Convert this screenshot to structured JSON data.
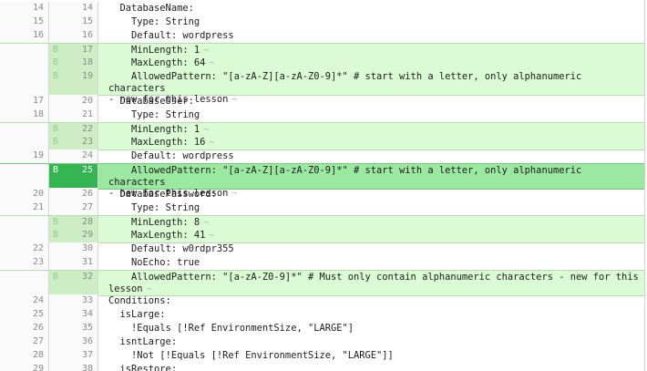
{
  "diff": {
    "added_marker": "B",
    "newline_glyph": "¬",
    "lines": [
      {
        "old": "14",
        "new": "14",
        "type": "context",
        "text": "  DatabaseName:",
        "nl": false
      },
      {
        "old": "15",
        "new": "15",
        "type": "context",
        "text": "    Type: String",
        "nl": false
      },
      {
        "old": "16",
        "new": "16",
        "type": "context",
        "text": "    Default: wordpress",
        "nl": false
      },
      {
        "old": "",
        "new": "17",
        "type": "added",
        "text": "    MinLength: 1",
        "nl": true
      },
      {
        "old": "",
        "new": "18",
        "type": "added",
        "text": "    MaxLength: 64",
        "nl": true
      },
      {
        "old": "",
        "new": "19",
        "type": "added",
        "text": "    AllowedPattern: \"[a-zA-Z][a-zA-Z0-9]*\" # start with a letter, only alphanumeric characters\n- new for this lesson",
        "nl": true
      },
      {
        "old": "17",
        "new": "20",
        "type": "context",
        "text": "  DatabaseUser:",
        "nl": false
      },
      {
        "old": "18",
        "new": "21",
        "type": "context",
        "text": "    Type: String",
        "nl": false
      },
      {
        "old": "",
        "new": "22",
        "type": "added",
        "text": "    MinLength: 1",
        "nl": true
      },
      {
        "old": "",
        "new": "23",
        "type": "added",
        "text": "    MaxLength: 16",
        "nl": true
      },
      {
        "old": "19",
        "new": "24",
        "type": "context",
        "text": "    Default: wordpress",
        "nl": false
      },
      {
        "old": "",
        "new": "25",
        "type": "added-selected",
        "text": "    AllowedPattern: \"[a-zA-Z][a-zA-Z0-9]*\" # start with a letter, only alphanumeric characters\n- new for this lesson",
        "nl": true
      },
      {
        "old": "20",
        "new": "26",
        "type": "context",
        "text": "  DatabasePassword:",
        "nl": false
      },
      {
        "old": "21",
        "new": "27",
        "type": "context",
        "text": "    Type: String",
        "nl": false
      },
      {
        "old": "",
        "new": "28",
        "type": "added",
        "text": "    MinLength: 8",
        "nl": true
      },
      {
        "old": "",
        "new": "29",
        "type": "added",
        "text": "    MaxLength: 41",
        "nl": true
      },
      {
        "old": "22",
        "new": "30",
        "type": "context",
        "text": "    Default: w0rdpr355",
        "nl": false
      },
      {
        "old": "23",
        "new": "31",
        "type": "context",
        "text": "    NoEcho: true",
        "nl": false
      },
      {
        "old": "",
        "new": "32",
        "type": "added",
        "text": "    AllowedPattern: \"[a-zA-Z0-9]*\" # Must only contain alphanumeric characters - new for this\nlesson",
        "nl": true
      },
      {
        "old": "24",
        "new": "33",
        "type": "context",
        "text": "Conditions:",
        "nl": false
      },
      {
        "old": "25",
        "new": "34",
        "type": "context",
        "text": "  isLarge:",
        "nl": false
      },
      {
        "old": "26",
        "new": "35",
        "type": "context",
        "text": "    !Equals [!Ref EnvironmentSize, \"LARGE\"]",
        "nl": false
      },
      {
        "old": "27",
        "new": "36",
        "type": "context",
        "text": "  isntLarge:",
        "nl": false
      },
      {
        "old": "28",
        "new": "37",
        "type": "context",
        "text": "    !Not [!Equals [!Ref EnvironmentSize, \"LARGE\"]]",
        "nl": false
      },
      {
        "old": "29",
        "new": "38",
        "type": "context",
        "text": "  isRestore:",
        "nl": false
      }
    ]
  }
}
